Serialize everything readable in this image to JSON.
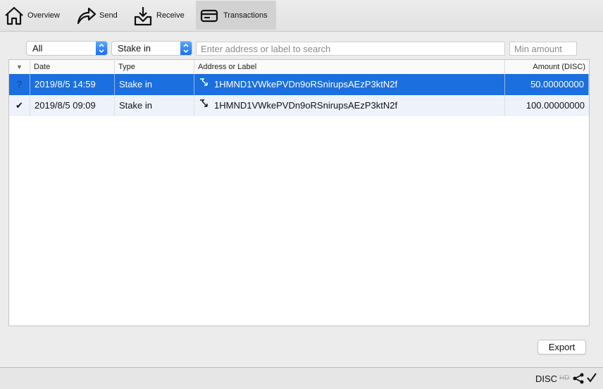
{
  "toolbar": {
    "tabs": [
      {
        "label": "Overview",
        "icon": "home-icon"
      },
      {
        "label": "Send",
        "icon": "send-icon"
      },
      {
        "label": "Receive",
        "icon": "receive-icon"
      },
      {
        "label": "Transactions",
        "icon": "card-icon",
        "active": true
      }
    ]
  },
  "filters": {
    "date_filter": "All",
    "type_filter": "Stake in",
    "search_placeholder": "Enter address or label to search",
    "min_amount_placeholder": "Min amount"
  },
  "table": {
    "headers": {
      "status": "▼",
      "date": "Date",
      "type": "Type",
      "address": "Address or Label",
      "amount": "Amount (DISC)"
    },
    "rows": [
      {
        "status": "?",
        "date": "2019/8/5 14:59",
        "type": "Stake in",
        "address": "1HMND1VWkePVDn9oRSnirupsAEzP3ktN2f",
        "amount": "50.00000000"
      },
      {
        "status": "✔",
        "date": "2019/8/5 09:09",
        "type": "Stake in",
        "address": "1HMND1VWkePVDn9oRSnirupsAEzP3ktN2f",
        "amount": "100.00000000"
      }
    ]
  },
  "actions": {
    "export_label": "Export"
  },
  "statusbar": {
    "unit": "DISC",
    "hd_label": "HD"
  },
  "colors": {
    "selection": "#1c6fde",
    "spinner": "#1a6ff2"
  }
}
